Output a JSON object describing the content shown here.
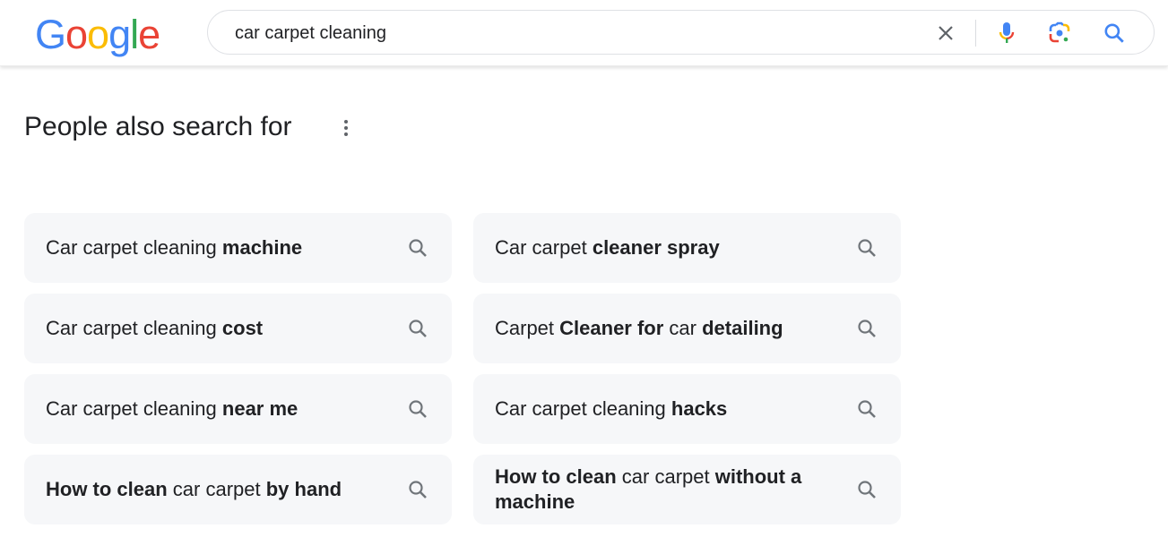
{
  "header": {
    "logo": {
      "letters": [
        {
          "char": "G",
          "color": "#4285F4"
        },
        {
          "char": "o",
          "color": "#EA4335"
        },
        {
          "char": "o",
          "color": "#FBBC05"
        },
        {
          "char": "g",
          "color": "#4285F4"
        },
        {
          "char": "l",
          "color": "#34A853"
        },
        {
          "char": "e",
          "color": "#EA4335"
        }
      ]
    },
    "search": {
      "value": "car carpet cleaning",
      "icons": [
        "close-icon",
        "microphone-icon",
        "google-lens-icon",
        "search-icon"
      ]
    }
  },
  "section": {
    "title": "People also search for",
    "more_icon": "more-vert-icon"
  },
  "suggestions": [
    {
      "parts": [
        {
          "t": "Car carpet cleaning ",
          "b": false
        },
        {
          "t": "machine",
          "b": true
        }
      ]
    },
    {
      "parts": [
        {
          "t": "Car carpet ",
          "b": false
        },
        {
          "t": "cleaner spray",
          "b": true
        }
      ]
    },
    {
      "parts": [
        {
          "t": "Car carpet cleaning ",
          "b": false
        },
        {
          "t": "cost",
          "b": true
        }
      ]
    },
    {
      "parts": [
        {
          "t": "Carpet ",
          "b": false
        },
        {
          "t": "Cleaner for",
          "b": true
        },
        {
          "t": " car ",
          "b": false
        },
        {
          "t": "detailing",
          "b": true
        }
      ]
    },
    {
      "parts": [
        {
          "t": "Car carpet cleaning ",
          "b": false
        },
        {
          "t": "near me",
          "b": true
        }
      ]
    },
    {
      "parts": [
        {
          "t": "Car carpet cleaning ",
          "b": false
        },
        {
          "t": "hacks",
          "b": true
        }
      ]
    },
    {
      "parts": [
        {
          "t": "How to clean",
          "b": true
        },
        {
          "t": " car carpet ",
          "b": false
        },
        {
          "t": "by hand",
          "b": true
        }
      ]
    },
    {
      "parts": [
        {
          "t": "How to clean",
          "b": true
        },
        {
          "t": " car carpet ",
          "b": false
        },
        {
          "t": "without a machine",
          "b": true
        }
      ]
    }
  ],
  "colors": {
    "chip_bg": "#f6f7f9",
    "text": "#202124",
    "icon_gray": "#70757a",
    "blue": "#4285F4"
  }
}
